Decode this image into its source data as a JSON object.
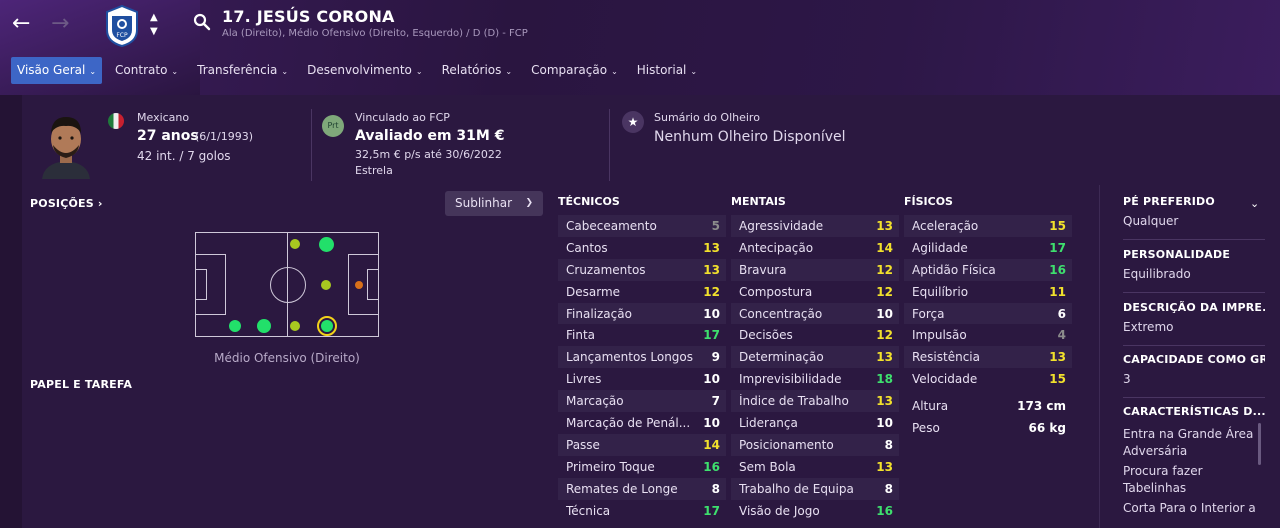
{
  "header": {
    "player_name": "17. JESÚS CORONA",
    "positions_line": "Ala (Direito), Médio Ofensivo (Direito, Esquerdo) / D (D) - FCP",
    "club_badge_letters": "FCP"
  },
  "tabs": [
    {
      "label": "Visão Geral"
    },
    {
      "label": "Contrato"
    },
    {
      "label": "Transferência"
    },
    {
      "label": "Desenvolvimento"
    },
    {
      "label": "Relatórios"
    },
    {
      "label": "Comparação"
    },
    {
      "label": "Historial"
    }
  ],
  "info": {
    "nationality": "Mexicano",
    "age": "27 anos",
    "birthdate": "(6/1/1993)",
    "caps": "42 int. / 7 golos",
    "contract_club": "Vinculado ao FCP",
    "prt_badge": "Prt",
    "value": "Avaliado em 31M €",
    "wage": "32,5m € p/s até 30/6/2022",
    "status": "Estrela",
    "scout_title": "Sumário do Olheiro",
    "scout_value": "Nenhum Olheiro Disponível"
  },
  "positions": {
    "heading": "POSIÇÕES",
    "highlight_button": "Sublinhar",
    "caption": "Médio Ofensivo (Direito)",
    "role_heading": "PAPEL E TAREFA",
    "colors": {
      "natural": "#22e06a",
      "accomplished": "#a8c820",
      "unconvincing": "#d8701a"
    }
  },
  "technical": {
    "heading": "TÉCNICOS",
    "items": [
      {
        "name": "Cabeceamento",
        "value": "5",
        "color": "#8c8c8c"
      },
      {
        "name": "Cantos",
        "value": "13",
        "color": "#f2e12c"
      },
      {
        "name": "Cruzamentos",
        "value": "13",
        "color": "#f2e12c"
      },
      {
        "name": "Desarme",
        "value": "12",
        "color": "#f2e12c"
      },
      {
        "name": "Finalização",
        "value": "10",
        "color": "#ffffff"
      },
      {
        "name": "Finta",
        "value": "17",
        "color": "#3ee06e"
      },
      {
        "name": "Lançamentos Longos",
        "value": "9",
        "color": "#ffffff"
      },
      {
        "name": "Livres",
        "value": "10",
        "color": "#ffffff"
      },
      {
        "name": "Marcação",
        "value": "7",
        "color": "#ffffff"
      },
      {
        "name": "Marcação de Penál...",
        "value": "10",
        "color": "#ffffff"
      },
      {
        "name": "Passe",
        "value": "14",
        "color": "#f2e12c"
      },
      {
        "name": "Primeiro Toque",
        "value": "16",
        "color": "#3ee06e"
      },
      {
        "name": "Remates de Longe",
        "value": "8",
        "color": "#ffffff"
      },
      {
        "name": "Técnica",
        "value": "17",
        "color": "#3ee06e"
      }
    ]
  },
  "mental": {
    "heading": "MENTAIS",
    "items": [
      {
        "name": "Agressividade",
        "value": "13",
        "color": "#f2e12c"
      },
      {
        "name": "Antecipação",
        "value": "14",
        "color": "#f2e12c"
      },
      {
        "name": "Bravura",
        "value": "12",
        "color": "#f2e12c"
      },
      {
        "name": "Compostura",
        "value": "12",
        "color": "#f2e12c"
      },
      {
        "name": "Concentração",
        "value": "10",
        "color": "#ffffff"
      },
      {
        "name": "Decisões",
        "value": "12",
        "color": "#f2e12c"
      },
      {
        "name": "Determinação",
        "value": "13",
        "color": "#f2e12c"
      },
      {
        "name": "Imprevisibilidade",
        "value": "18",
        "color": "#3ee06e"
      },
      {
        "name": "Índice de Trabalho",
        "value": "13",
        "color": "#f2e12c"
      },
      {
        "name": "Liderança",
        "value": "10",
        "color": "#ffffff"
      },
      {
        "name": "Posicionamento",
        "value": "8",
        "color": "#ffffff"
      },
      {
        "name": "Sem Bola",
        "value": "13",
        "color": "#f2e12c"
      },
      {
        "name": "Trabalho de Equipa",
        "value": "8",
        "color": "#ffffff"
      },
      {
        "name": "Visão de Jogo",
        "value": "16",
        "color": "#3ee06e"
      }
    ]
  },
  "physical": {
    "heading": "FÍSICOS",
    "items": [
      {
        "name": "Aceleração",
        "value": "15",
        "color": "#f2e12c"
      },
      {
        "name": "Agilidade",
        "value": "17",
        "color": "#3ee06e"
      },
      {
        "name": "Aptidão Física",
        "value": "16",
        "color": "#3ee06e"
      },
      {
        "name": "Equilíbrio",
        "value": "11",
        "color": "#f2e12c"
      },
      {
        "name": "Força",
        "value": "6",
        "color": "#ffffff"
      },
      {
        "name": "Impulsão",
        "value": "4",
        "color": "#8c8c8c"
      },
      {
        "name": "Resistência",
        "value": "13",
        "color": "#f2e12c"
      },
      {
        "name": "Velocidade",
        "value": "15",
        "color": "#f2e12c"
      }
    ],
    "height_label": "Altura",
    "height_value": "173 cm",
    "weight_label": "Peso",
    "weight_value": "66 kg"
  },
  "right_panel": {
    "preferred_foot_title": "PÉ PREFERIDO",
    "preferred_foot_value": "Qualquer",
    "personality_title": "PERSONALIDADE",
    "personality_value": "Equilibrado",
    "media_title": "DESCRIÇÃO DA IMPRE...",
    "media_value": "Extremo",
    "gk_title": "CAPACIDADE COMO GR",
    "gk_value": "3",
    "traits_title": "CARACTERÍSTICAS D...",
    "traits": [
      "Entra na Grande Área Adversária",
      "Procura fazer Tabelinhas",
      "Corta Para o Interior a"
    ]
  }
}
